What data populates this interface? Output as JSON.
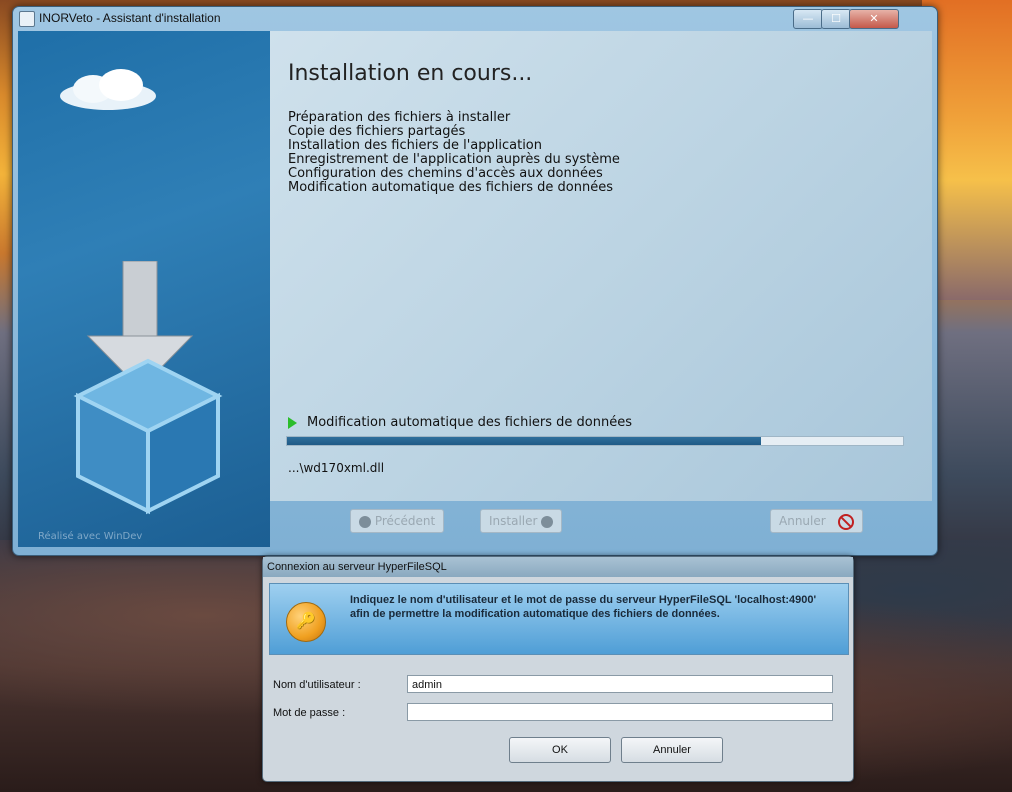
{
  "installer": {
    "title": "INORVeto - Assistant d'installation",
    "heading": "Installation en cours...",
    "steps": [
      "Préparation des fichiers à installer",
      "Copie des fichiers partagés",
      "Installation des fichiers de l'application",
      "Enregistrement de l'application auprès du système",
      "Configuration des chemins d'accès aux données",
      "Modification automatique des fichiers de données"
    ],
    "current_step": "Modification automatique des fichiers de données",
    "progress_fraction": 0.77,
    "current_file": "...\\wd170xml.dll",
    "side_label": "Réalisé avec WinDev",
    "buttons": {
      "previous": "Précédent",
      "install": "Installer",
      "cancel": "Annuler"
    }
  },
  "dialog": {
    "title": "Connexion au serveur HyperFileSQL",
    "message": "Indiquez le nom d'utilisateur et le mot de passe du serveur HyperFileSQL 'localhost:4900' afin de permettre la modification automatique des fichiers de données.",
    "username_label": "Nom d'utilisateur :",
    "username_value": "admin",
    "password_label": "Mot de passe :",
    "password_value": "",
    "ok_label": "OK",
    "cancel_label": "Annuler"
  }
}
